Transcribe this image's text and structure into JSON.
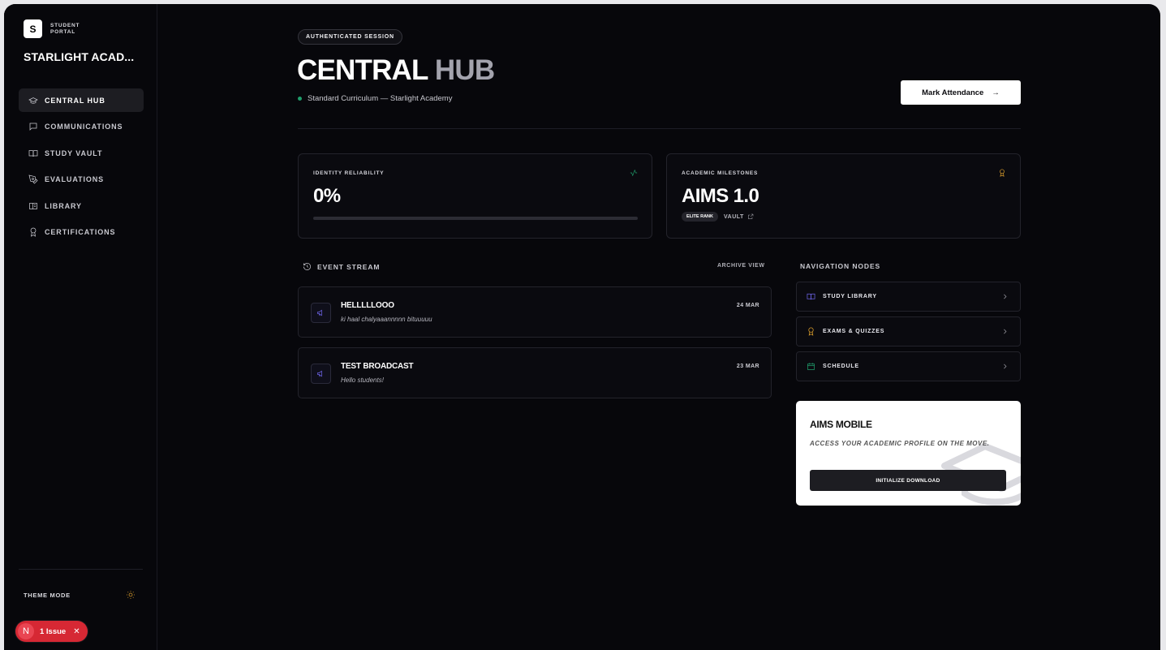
{
  "brand": {
    "logo_letter": "S",
    "portal_label": "STUDENT PORTAL",
    "school_name": "STARLIGHT ACAD..."
  },
  "sidebar": {
    "items": [
      {
        "label": "CENTRAL HUB",
        "icon": "graduation-cap-icon",
        "active": true
      },
      {
        "label": "COMMUNICATIONS",
        "icon": "message-square-icon",
        "active": false
      },
      {
        "label": "STUDY VAULT",
        "icon": "book-open-icon",
        "active": false
      },
      {
        "label": "EVALUATIONS",
        "icon": "pen-tool-icon",
        "active": false
      },
      {
        "label": "LIBRARY",
        "icon": "library-book-icon",
        "active": false
      },
      {
        "label": "CERTIFICATIONS",
        "icon": "award-icon",
        "active": false
      }
    ],
    "theme_label": "THEME MODE",
    "theme_icon": "sun-icon"
  },
  "issue": {
    "letter": "N",
    "label": "1 Issue",
    "close": "✕",
    "color": "#d62834"
  },
  "header": {
    "badge": "AUTHENTICATED SESSION",
    "title_part1": "CENTRAL",
    "title_part2": "HUB",
    "subtitle": "Standard Curriculum — Starlight Academy",
    "cta_label": "Mark Attendance",
    "cta_arrow": "→"
  },
  "stats": {
    "identity": {
      "label": "IDENTITY RELIABILITY",
      "value": "0%",
      "progress": 0,
      "icon": "activity-icon",
      "icon_color": "#1f9d6b"
    },
    "milestones": {
      "label": "ACADEMIC MILESTONES",
      "value": "AIMS 1.0",
      "rank": "ELITE RANK",
      "vault": "VAULT",
      "icon": "award-icon",
      "icon_color": "#e0a12c"
    }
  },
  "events": {
    "heading": "EVENT STREAM",
    "archive": "ARCHIVE VIEW",
    "items": [
      {
        "title": "HELLLLLOOO",
        "message": "ki haal chalyaaannnnn bituuuuu",
        "date": "24 MAR"
      },
      {
        "title": "TEST BROADCAST",
        "message": "Hello students!",
        "date": "23 MAR"
      }
    ]
  },
  "navigation": {
    "heading": "NAVIGATION NODES",
    "items": [
      {
        "label": "STUDY LIBRARY",
        "icon": "book-open-icon",
        "color": "#6e64e8"
      },
      {
        "label": "EXAMS & QUIZZES",
        "icon": "award-icon",
        "color": "#e0a12c"
      },
      {
        "label": "SCHEDULE",
        "icon": "calendar-icon",
        "color": "#1f9d6b"
      }
    ]
  },
  "mobile": {
    "title": "AIMS MOBILE",
    "description": "ACCESS YOUR ACADEMIC PROFILE ON THE MOVE.",
    "button": "INITIALIZE DOWNLOAD"
  }
}
